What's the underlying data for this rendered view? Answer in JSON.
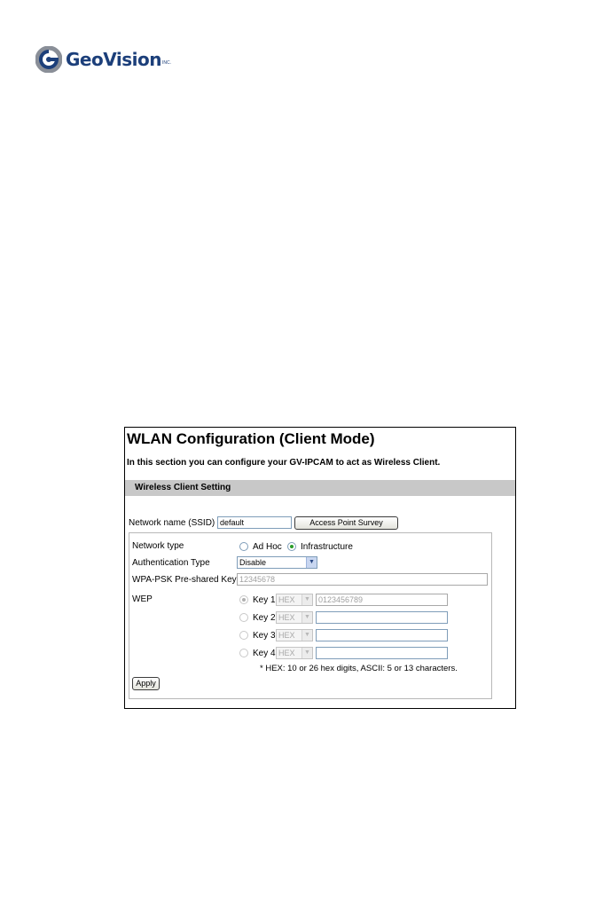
{
  "brand": {
    "name": "GeoVision",
    "tm": "INC."
  },
  "page": {
    "title": "WLAN Configuration (Client Mode)",
    "intro": "In this section you can configure your GV-IPCAM to act as Wireless Client.",
    "section": "Wireless Client Setting"
  },
  "ssid": {
    "label": "Network name (SSID)",
    "value": "default",
    "survey_button": "Access Point Survey"
  },
  "network_type": {
    "label": "Network type",
    "options": [
      "Ad Hoc",
      "Infrastructure"
    ],
    "selected": "Infrastructure"
  },
  "auth": {
    "label": "Authentication Type",
    "value": "Disable"
  },
  "wpa": {
    "label": "WPA-PSK Pre-shared Key",
    "value": "12345678"
  },
  "wep": {
    "label": "WEP",
    "keys": [
      {
        "label": "Key 1",
        "format": "HEX",
        "value": "0123456789",
        "selected": true
      },
      {
        "label": "Key 2",
        "format": "HEX",
        "value": "",
        "selected": false
      },
      {
        "label": "Key 3",
        "format": "HEX",
        "value": "",
        "selected": false
      },
      {
        "label": "Key 4",
        "format": "HEX",
        "value": "",
        "selected": false
      }
    ],
    "note": "* HEX: 10 or 26 hex digits, ASCII: 5 or 13 characters."
  },
  "apply_button": "Apply",
  "colors": {
    "section_bar": "#c8c8c8",
    "logo": "#1c3f7a",
    "radio_dot": "#2a9d2a"
  },
  "icons": {
    "logo": "geovision-logo-icon",
    "dropdown": "chevron-down-icon"
  }
}
